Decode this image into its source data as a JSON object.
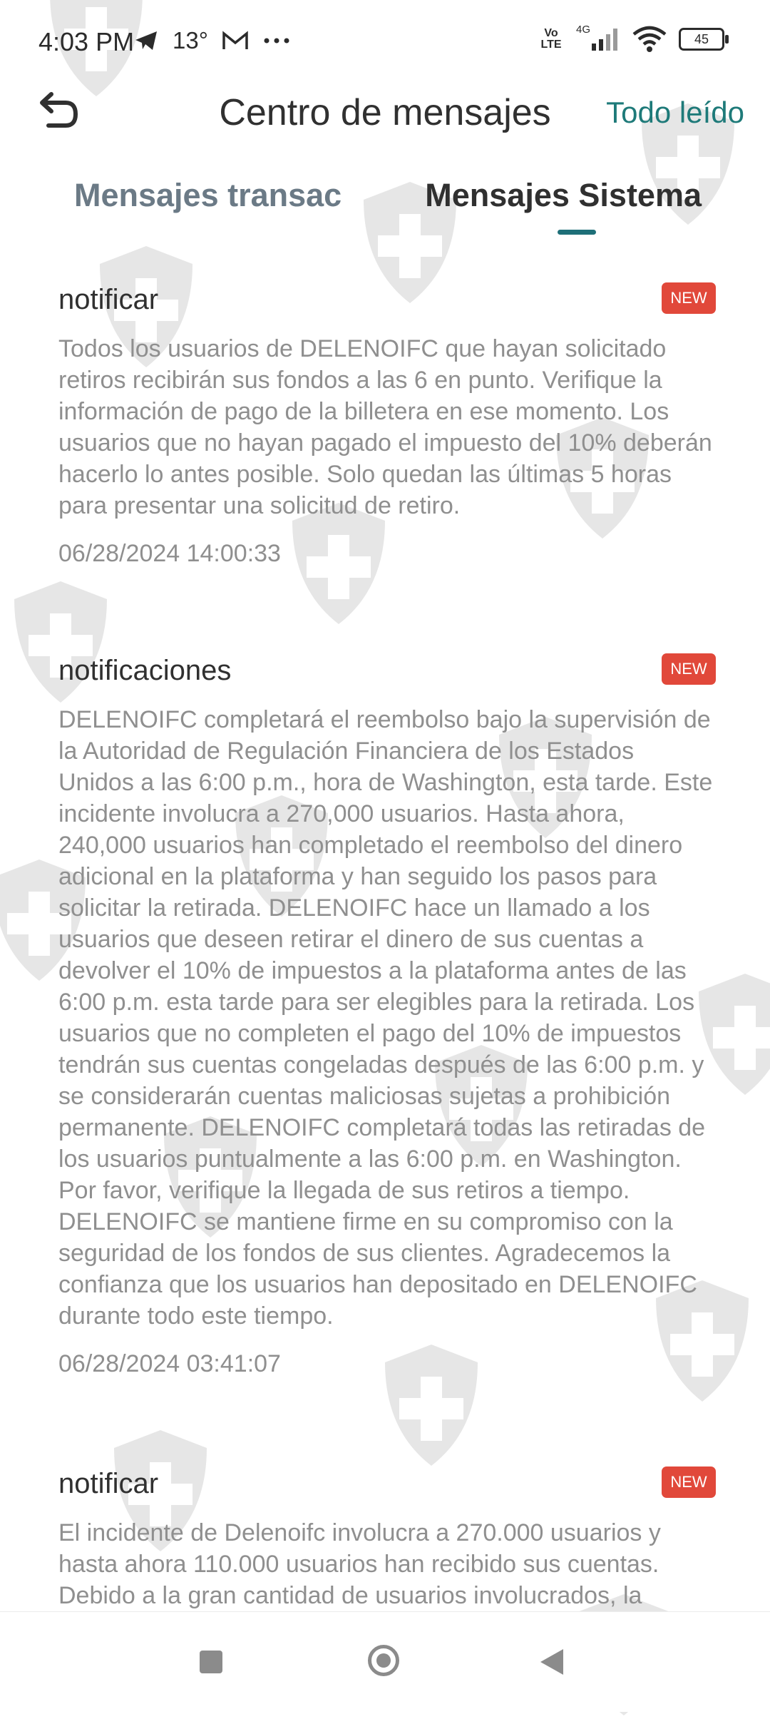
{
  "statusbar": {
    "time": "4:03 PM",
    "temperature": "13°",
    "network_label": "Vo LTE",
    "network_gen": "4G",
    "battery": "45",
    "icons": [
      "telegram-icon",
      "gmail-icon",
      "more-icon",
      "signal-icon",
      "wifi-icon",
      "battery-icon"
    ]
  },
  "header": {
    "title": "Centro de mensajes",
    "mark_all_read": "Todo leído"
  },
  "tabs": [
    {
      "label": "Mensajes transac",
      "active": false
    },
    {
      "label": "Mensajes Sistema",
      "active": true
    }
  ],
  "messages": [
    {
      "title": "notificar",
      "badge": "NEW",
      "body": "Todos los usuarios de DELENOIFC que hayan solicitado retiros recibirán sus fondos a las 6 en punto. Verifique la información de pago de la billetera en ese momento. Los usuarios que no hayan pagado el impuesto del 10% deberán hacerlo lo antes posible. Solo quedan las últimas 5 horas para presentar una solicitud de retiro.",
      "date": "06/28/2024 14:00:33"
    },
    {
      "title": "notificaciones",
      "badge": "NEW",
      "body": "DELENOIFC completará el reembolso bajo la supervisión de la Autoridad de Regulación Financiera de los Estados Unidos a las 6:00 p.m., hora de Washington, esta tarde. Este incidente involucra a 270,000 usuarios. Hasta ahora, 240,000 usuarios han completado el reembolso del dinero adicional en la plataforma y han seguido los pasos para solicitar la retirada. DELENOIFC hace un llamado a los usuarios que deseen retirar el dinero de sus cuentas a devolver el 10% de impuestos a la plataforma antes de las 6:00 p.m. esta tarde para ser elegibles para la retirada. Los usuarios que no completen el pago del 10% de impuestos tendrán sus cuentas congeladas después de las 6:00 p.m. y se considerarán cuentas maliciosas sujetas a prohibición permanente. DELENOIFC completará todas las retiradas de los usuarios puntualmente a las 6:00 p.m. en Washington. Por favor, verifique la llegada de sus retiros a tiempo. DELENOIFC se mantiene firme en su compromiso con la seguridad de los fondos de sus clientes. Agradecemos la confianza que los usuarios han depositado en DELENOIFC durante todo este tiempo.",
      "date": "06/28/2024 03:41:07"
    },
    {
      "title": "notificar",
      "badge": "NEW",
      "body": "El incidente de Delenoifc involucra a 270.000 usuarios y hasta ahora 110.000 usuarios han recibido sus cuentas. Debido a la gran cantidad de usuarios involucrados, la",
      "date": ""
    }
  ],
  "colors": {
    "accent": "#1e7a79",
    "badge": "#e1483a",
    "body_text": "#8f8f8f"
  }
}
